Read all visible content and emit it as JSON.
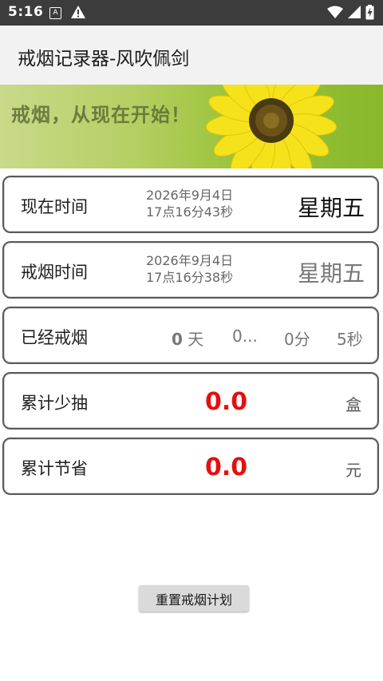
{
  "status_bar": {
    "time": "5:16",
    "icons": [
      "a-box-icon",
      "warning-icon",
      "wifi-icon",
      "signal-icon",
      "battery-icon"
    ]
  },
  "app_bar": {
    "title": "戒烟记录器-风吹佩剑"
  },
  "banner": {
    "slogan": "戒烟，从现在开始！"
  },
  "cards": {
    "now": {
      "label": "现在时间",
      "date": "2026年9月4日",
      "time": "17点16分43秒",
      "weekday": "星期五"
    },
    "quit": {
      "label": "戒烟时间",
      "date": "2026年9月4日",
      "time": "17点16分38秒",
      "weekday": "星期五"
    },
    "elapsed": {
      "label": "已经戒烟",
      "days_value": "0",
      "days_unit": "天",
      "hours": "0...",
      "minutes": "0分",
      "seconds": "5秒"
    },
    "packs": {
      "label": "累计少抽",
      "value": "0.0",
      "unit": "盒"
    },
    "money": {
      "label": "累计节省",
      "value": "0.0",
      "unit": "元"
    }
  },
  "reset_button": {
    "label": "重置戒烟计划"
  },
  "colors": {
    "status_bar": "#3c3c3c",
    "app_bar": "#f2f2f2",
    "accent_value": "#e41010",
    "card_border": "#5a5a5a",
    "button": "#dadada"
  }
}
